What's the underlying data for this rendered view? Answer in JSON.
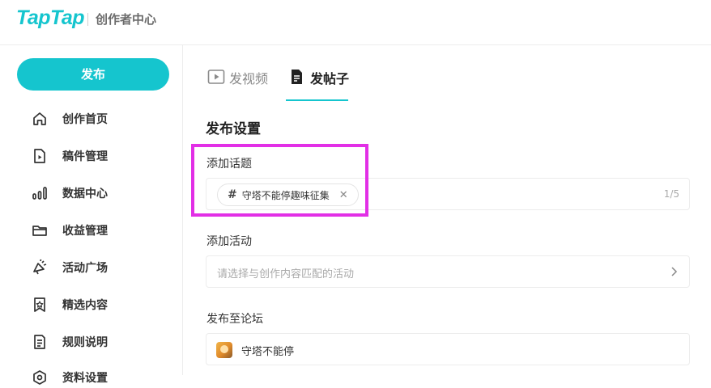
{
  "header": {
    "logo": "TapTap",
    "subtitle": "创作者中心"
  },
  "sidebar": {
    "publish_label": "发布",
    "items": [
      {
        "label": "创作首页",
        "icon": "home-icon"
      },
      {
        "label": "稿件管理",
        "icon": "document-play-icon"
      },
      {
        "label": "数据中心",
        "icon": "bar-chart-icon"
      },
      {
        "label": "收益管理",
        "icon": "wallet-icon"
      },
      {
        "label": "活动广场",
        "icon": "megaphone-icon"
      },
      {
        "label": "精选内容",
        "icon": "star-badge-icon"
      },
      {
        "label": "规则说明",
        "icon": "rules-document-icon"
      },
      {
        "label": "资料设置",
        "icon": "settings-icon"
      }
    ]
  },
  "tabs": [
    {
      "label": "发视频",
      "icon": "video-play-icon",
      "active": false
    },
    {
      "label": "发帖子",
      "icon": "post-document-icon",
      "active": true
    }
  ],
  "publish_settings": {
    "title": "发布设置",
    "topic": {
      "label": "添加话题",
      "chip_prefix": "#",
      "chip_text": "守塔不能停趣味征集",
      "counter": "1/5"
    },
    "activity": {
      "label": "添加活动",
      "placeholder": "请选择与创作内容匹配的活动"
    },
    "forum": {
      "label": "发布至论坛",
      "name": "守塔不能停"
    }
  },
  "colors": {
    "accent": "#15c5ce",
    "highlight": "#e22fe6"
  }
}
